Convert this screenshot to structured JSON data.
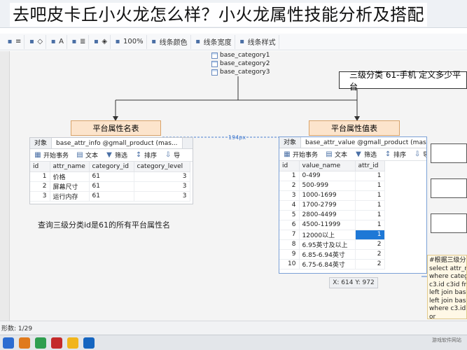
{
  "overlay_title": "去吧皮卡丘小火龙怎么样？小火龙属性技能分析及搭配",
  "toolbar": {
    "items": [
      {
        "icon": "layout-icon",
        "label": "≡"
      },
      {
        "icon": "fill-icon",
        "label": "◇"
      },
      {
        "icon": "font-color-icon",
        "label": "A"
      },
      {
        "icon": "align-icon",
        "label": "≣"
      },
      {
        "icon": "brush-icon",
        "label": "◈"
      },
      {
        "icon": "zoom-icon",
        "label": "100%"
      },
      {
        "icon": "line-color-icon",
        "label": "线条颜色"
      },
      {
        "icon": "line-width-icon",
        "label": "线条宽度"
      },
      {
        "icon": "line-style-icon",
        "label": "线条样式"
      }
    ]
  },
  "categories": [
    "base_category1",
    "base_category2",
    "base_category3"
  ],
  "top_note": "三级分类 61-手机 定义多少平台",
  "left_header": "平台属性名表",
  "right_header": "平台属性值表",
  "dim_label": "194px",
  "left_panel": {
    "tabs": [
      "对象",
      "base_attr_info @gmall_product (mas..."
    ],
    "tools": [
      "开始事务",
      "文本",
      "筛选",
      "排序",
      "导"
    ],
    "columns": [
      "id",
      "attr_name",
      "category_id",
      "category_level"
    ],
    "rows": [
      [
        "1",
        "价格",
        "61",
        "3"
      ],
      [
        "2",
        "屏幕尺寸",
        "61",
        "3"
      ],
      [
        "3",
        "运行内存",
        "61",
        "3"
      ]
    ]
  },
  "right_panel": {
    "tabs": [
      "对象",
      "base_attr_value @gmall_product (mas..."
    ],
    "tools": [
      "开始事务",
      "文本",
      "筛选",
      "排序",
      "导入"
    ],
    "columns": [
      "id",
      "value_name",
      "attr_id"
    ],
    "rows": [
      [
        "1",
        "0-499",
        "1"
      ],
      [
        "2",
        "500-999",
        "1"
      ],
      [
        "3",
        "1000-1699",
        "1"
      ],
      [
        "4",
        "1700-2799",
        "1"
      ],
      [
        "5",
        "2800-4499",
        "1"
      ],
      [
        "6",
        "4500-11999",
        "1"
      ],
      [
        "7",
        "12000以上",
        "1"
      ],
      [
        "8",
        "6.95英寸及以上",
        "2"
      ],
      [
        "9",
        "6.85-6.94英寸",
        "2"
      ],
      [
        "10",
        "6.75-6.84英寸",
        "2"
      ]
    ],
    "selected_attr_row": 6
  },
  "bottom_note": "查询三级分类id是61的所有平台属性名",
  "coord_readout": "X: 614  Y: 972",
  "sql_lines": [
    "#根据三级分类",
    "select attr_na",
    "where catego",
    "c3.id c3id fro",
    "left join base_",
    "left join base_",
    "where c3.id=6",
    "or"
  ],
  "status": "形数: 1/29",
  "watermark": "游戏软件网站",
  "colors": {
    "accent": "#1e78d6",
    "orange_box": "#fce4cc",
    "red_mark": "#d0302a"
  }
}
